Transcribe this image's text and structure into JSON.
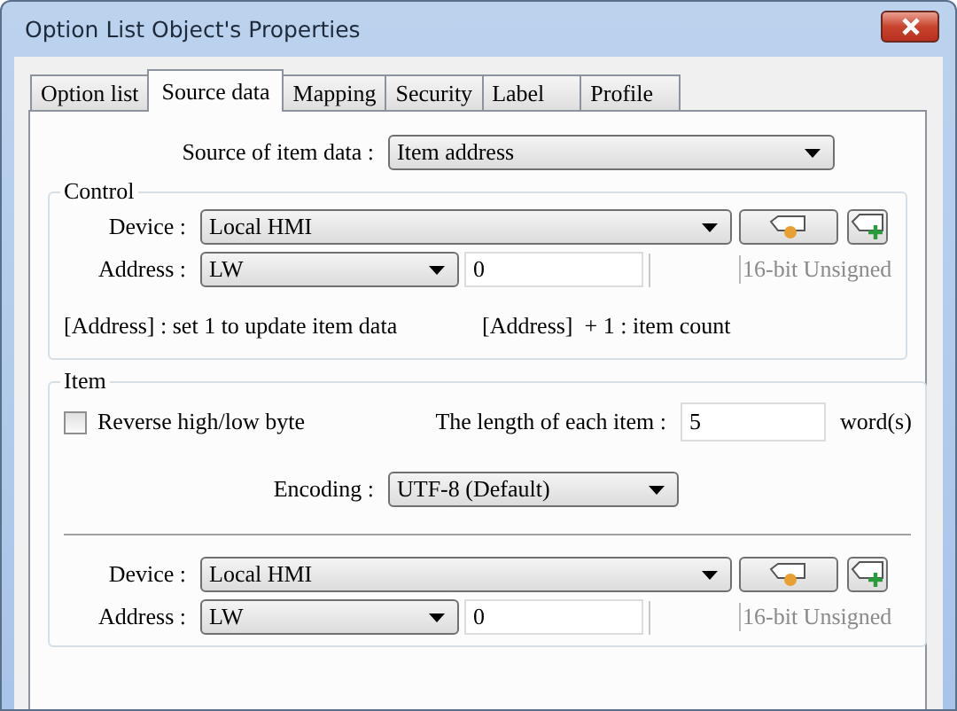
{
  "window": {
    "title": "Option List Object's Properties"
  },
  "tabs": [
    {
      "label": "Option list",
      "selected": false
    },
    {
      "label": "Source data",
      "selected": true
    },
    {
      "label": "Mapping",
      "selected": false
    },
    {
      "label": "Security",
      "selected": false
    },
    {
      "label": "Label",
      "selected": false
    },
    {
      "label": "Profile",
      "selected": false
    }
  ],
  "source": {
    "label": "Source of item data :",
    "value": "Item address"
  },
  "control": {
    "title": "Control",
    "device": {
      "label": "Device :",
      "value": "Local HMI"
    },
    "address": {
      "label": "Address :",
      "type": "LW",
      "value": "0",
      "format": "16-bit Unsigned"
    },
    "notes": [
      "[Address] : set 1 to update item data",
      "[Address]  + 1 : item count"
    ]
  },
  "item": {
    "title": "Item",
    "reverse": {
      "label": "Reverse high/low byte",
      "checked": false
    },
    "length": {
      "label": "The length of each item :",
      "value": "5",
      "unit": "word(s)"
    },
    "encoding": {
      "label": "Encoding :",
      "value": "UTF-8 (Default)"
    },
    "device": {
      "label": "Device :",
      "value": "Local HMI"
    },
    "address": {
      "label": "Address :",
      "type": "LW",
      "value": "0",
      "format": "16-bit Unsigned"
    }
  }
}
